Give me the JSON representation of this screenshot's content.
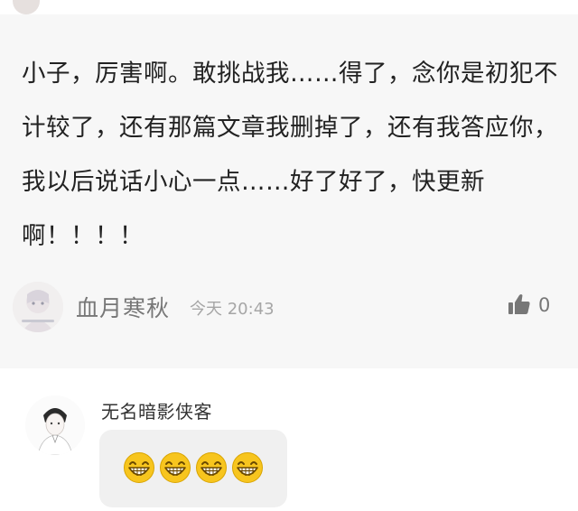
{
  "comment": {
    "text": "小子，厉害啊。敢挑战我……得了，念你是初犯不计较了，还有那篇文章我删掉了，还有我答应你，我以后说话小心一点……好了好了，快更新啊！！！！",
    "author": "血月寒秋",
    "timestamp": "今天 20:43",
    "like_count": "0",
    "icons": {
      "like": "thumbs-up-icon",
      "avatar": "avatar-image"
    }
  },
  "reply": {
    "author": "无名暗影侠客",
    "emoji_count": 4,
    "emoji_name": "laughing-face-emoji"
  },
  "colors": {
    "card_background": "#f7f7f7",
    "text_primary": "#222222",
    "text_secondary": "#777777",
    "timestamp": "#a6a6a6",
    "bubble_background": "#f0f0f0",
    "emoji_yellow": "#f7c51e"
  }
}
